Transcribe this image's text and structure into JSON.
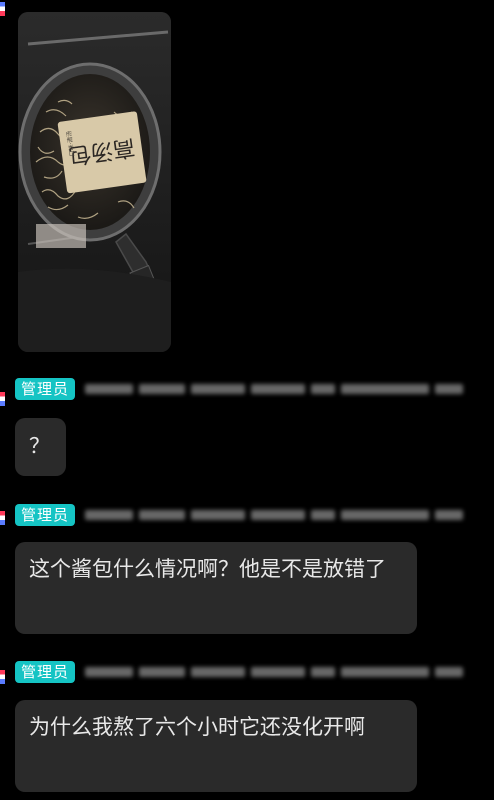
{
  "messages": [
    {
      "sender_badge": "管理员",
      "text": "？"
    },
    {
      "sender_badge": "管理员",
      "text": "这个酱包什么情况啊？他是不是放错了"
    },
    {
      "sender_badge": "管理员",
      "text": "为什么我熬了六个小时它还没化开啊"
    }
  ],
  "photo": {
    "packet_text": "高汤包",
    "packet_small_text": "口味·清汤"
  },
  "colors": {
    "badge": "#15c4c4",
    "bubble": "#2a2a2a",
    "background": "#000000"
  }
}
